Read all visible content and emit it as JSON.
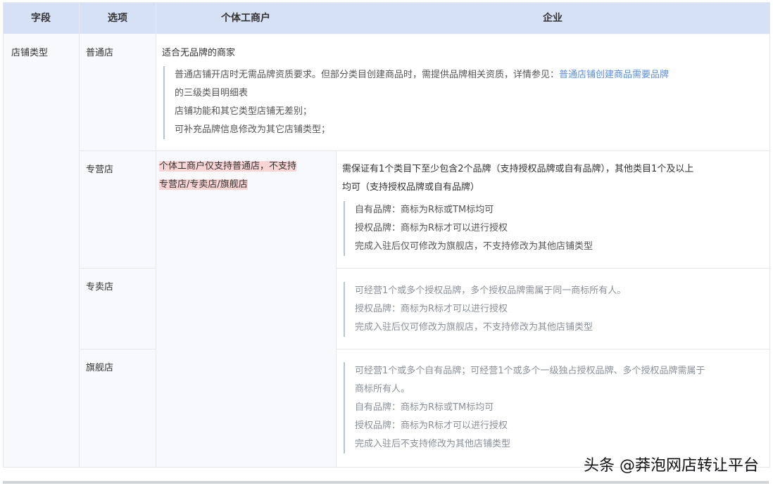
{
  "headers": {
    "field": "字段",
    "option": "选项",
    "individual": "个体工商户",
    "enterprise": "企业"
  },
  "field_name": "店铺类型",
  "rows": {
    "normal": {
      "option": "普通店",
      "summary": "适合无品牌的商家",
      "note_line1": "普通店铺开店时无需品牌资质要求。但部分类目创建商品时，需提供品牌相关资质，详情参见：",
      "note_link_a": "普通店铺创建商品需要品牌",
      "note_link_b": "的三级类目明细表",
      "note_line2": "店铺功能和其它类型店铺无差别；",
      "note_line3": "可补充品牌信息修改为其它店铺类型；"
    },
    "exclusive": {
      "option": "专营店",
      "individual_note_1": "个体工商户仅支持普通店，不支持",
      "individual_note_2": "专营店/专卖店/旗舰店",
      "summary_1": "需保证有1个类目下至少包含2个品牌（支持授权品牌或自有品牌），其他类目1个及以上",
      "summary_2": "均可（支持授权品牌或自有品牌）",
      "note_line1": "自有品牌：商标为R标或TM标均可",
      "note_line2": "授权品牌：商标为R标才可以进行授权",
      "note_line3": "完成入驻后仅可修改为旗舰店，不支持修改为其他店铺类型"
    },
    "specialty": {
      "option": "专卖店",
      "note_line1": "可经营1个或多个授权品牌，多个授权品牌需属于同一商标所有人。",
      "note_line2": "授权品牌：商标为R标才可以进行授权",
      "note_line3": "完成入驻后仅可修改为旗舰店，不支持修改为其他店铺类型"
    },
    "flagship": {
      "option": "旗舰店",
      "note_line1": "可经营1个或多个自有品牌；可经营1个或多个一级独占授权品牌、多个授权品牌需属于",
      "note_line2": "商标所有人。",
      "note_line3": "自有品牌：商标为R标或TM标均可",
      "note_line4": "授权品牌：商标为R标才可以进行授权",
      "note_line5": "完成入驻后不支持修改为其他店铺类型"
    }
  },
  "watermark": "头条 @莽泡网店转让平台",
  "colors": {
    "header_bg": "#d6e1f5",
    "link": "#5a8de0",
    "highlight": "#f9d5d5"
  }
}
